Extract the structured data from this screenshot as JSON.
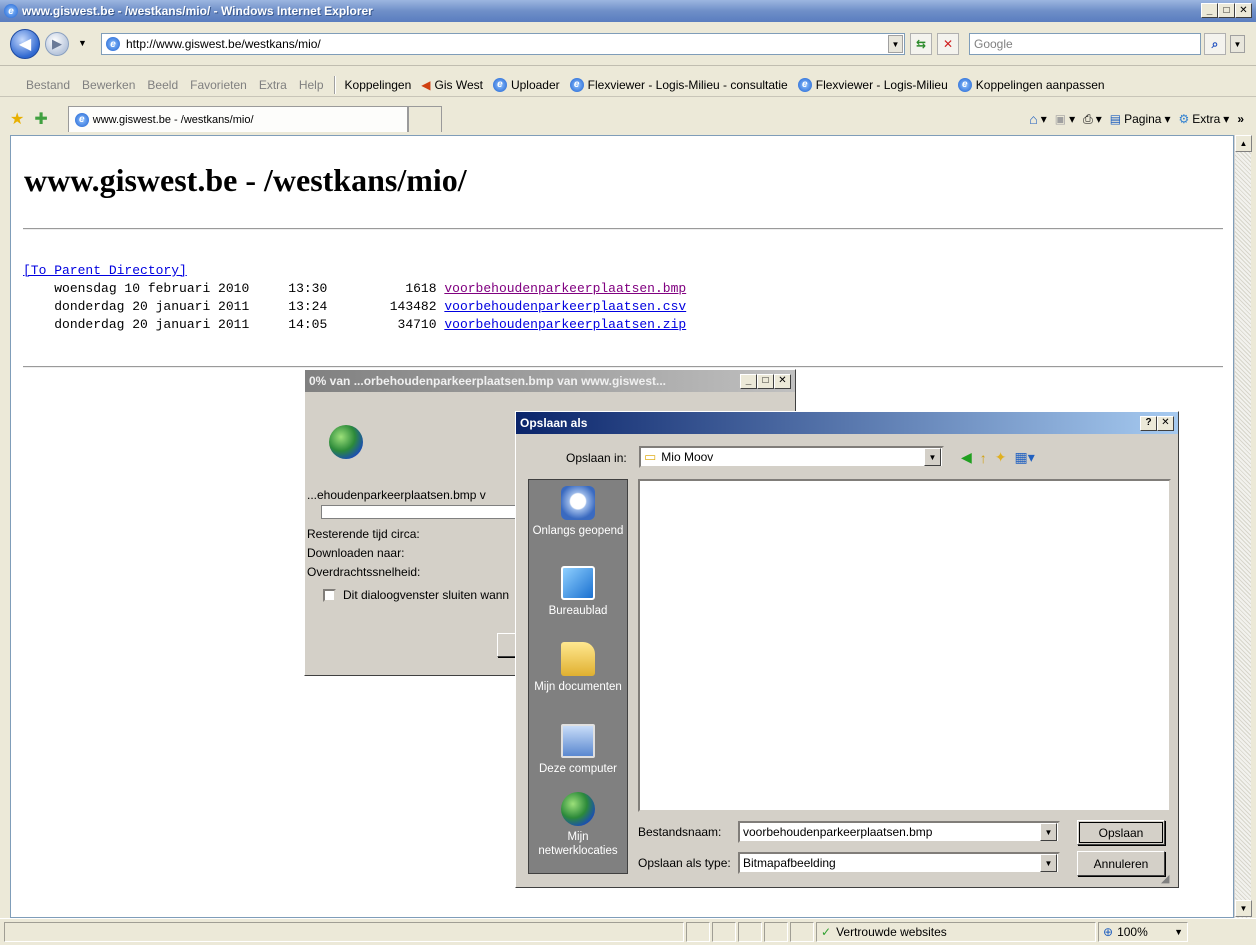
{
  "window": {
    "title": "www.giswest.be - /westkans/mio/ - Windows Internet Explorer"
  },
  "addressbar": {
    "url": "http://www.giswest.be/westkans/mio/",
    "search_placeholder": "Google"
  },
  "menu": {
    "items": [
      "Bestand",
      "Bewerken",
      "Beeld",
      "Favorieten",
      "Extra",
      "Help"
    ]
  },
  "links": {
    "label": "Koppelingen",
    "items": [
      "Gis West",
      "Uploader",
      "Flexviewer - Logis-Milieu - consultatie",
      "Flexviewer - Logis-Milieu",
      "Koppelingen aanpassen"
    ]
  },
  "tab": {
    "label": "www.giswest.be - /westkans/mio/"
  },
  "commandbar": {
    "page_label": "Pagina",
    "extra_label": "Extra"
  },
  "page": {
    "heading": "www.giswest.be - /westkans/mio/",
    "parent_link": "[To Parent Directory]",
    "files": [
      {
        "date": "woensdag 10 februari 2010",
        "time": "13:30",
        "size": "1618",
        "name": "voorbehoudenparkeerplaatsen.bmp",
        "visited": true
      },
      {
        "date": "donderdag 20 januari 2011",
        "time": "13:24",
        "size": "143482",
        "name": "voorbehoudenparkeerplaatsen.csv",
        "visited": false
      },
      {
        "date": "donderdag 20 januari 2011",
        "time": "14:05",
        "size": "34710",
        "name": "voorbehoudenparkeerplaatsen.zip",
        "visited": false
      }
    ]
  },
  "download_dialog": {
    "title": "0% van ...orbehoudenparkeerplaatsen.bmp van www.giswest...",
    "filename": "...ehoudenparkeerplaatsen.bmp v",
    "remaining_label": "Resterende tijd circa:",
    "download_to_label": "Downloaden naar:",
    "speed_label": "Overdrachtssnelheid:",
    "close_checkbox_label": "Dit dialoogvenster sluiten wann"
  },
  "save_dialog": {
    "title": "Opslaan als",
    "save_in_label": "Opslaan in:",
    "save_in_value": "Mio Moov",
    "places": [
      "Onlangs geopend",
      "Bureaublad",
      "Mijn documenten",
      "Deze computer",
      "Mijn netwerklocaties"
    ],
    "filename_label": "Bestandsnaam:",
    "filename_value": "voorbehoudenparkeerplaatsen.bmp",
    "type_label": "Opslaan als type:",
    "type_value": "Bitmapafbeelding",
    "save_button": "Opslaan",
    "cancel_button": "Annuleren",
    "help_button": "?"
  },
  "statusbar": {
    "zone": "Vertrouwde websites",
    "zoom": "100%"
  },
  "colors": {
    "link": "#0000e0",
    "visited": "#800080",
    "titlebar_active": "#0a246a"
  }
}
